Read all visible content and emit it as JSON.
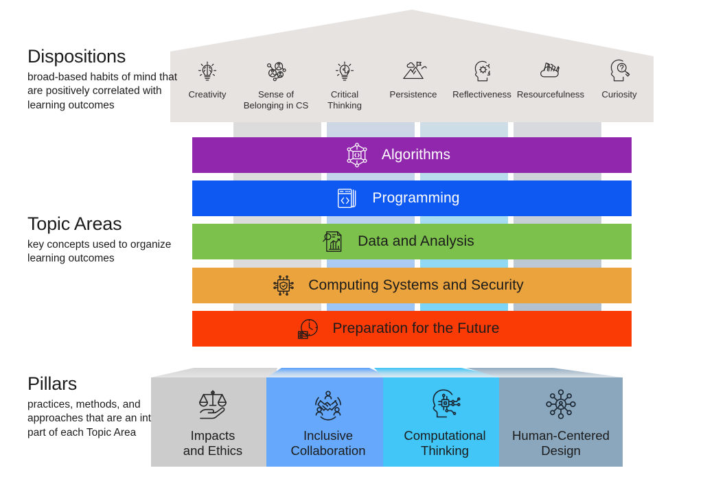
{
  "sections": [
    {
      "key": "dispositions",
      "title": "Dispositions",
      "desc": "broad-based habits of mind that are positively correlated with learning outcomes"
    },
    {
      "key": "topic_areas",
      "title": "Topic Areas",
      "desc": "key concepts used to organize learning outcomes"
    },
    {
      "key": "pillars",
      "title": "Pillars",
      "desc": "practices, methods, and approaches that are an integral part of each Topic Area"
    }
  ],
  "dispositions": {
    "background_color": "#e7e3e0",
    "items": [
      {
        "label": "Creativity",
        "icon": "lightbulb-brain-icon"
      },
      {
        "label": "Sense of\nBelonging in CS",
        "icon": "people-network-icon"
      },
      {
        "label": "Critical\nThinking",
        "icon": "lightbulb-puzzle-icon"
      },
      {
        "label": "Persistence",
        "icon": "mountain-flag-icon"
      },
      {
        "label": "Reflectiveness",
        "icon": "head-gear-icon"
      },
      {
        "label": "Resourcefulness",
        "icon": "toolbox-supplies-icon"
      },
      {
        "label": "Curiosity",
        "icon": "head-magnifier-icon"
      }
    ]
  },
  "topic_areas": {
    "bars": [
      {
        "label": "Algorithms",
        "color": "#9127ac",
        "text_color": "#ffffff",
        "icon": "algorithm-node-icon"
      },
      {
        "label": "Programming",
        "color": "#0d59f2",
        "text_color": "#ffffff",
        "icon": "code-window-icon"
      },
      {
        "label": "Data and Analysis",
        "color": "#7cc14b",
        "text_color": "#1b1b1b",
        "icon": "data-chart-magnifier-icon"
      },
      {
        "label": "Computing Systems and Security",
        "color": "#eba33e",
        "text_color": "#1b1b1b",
        "icon": "chip-shield-icon"
      },
      {
        "label": "Preparation for the Future",
        "color": "#fb3b05",
        "text_color": "#1b1b1b",
        "icon": "clock-books-icon"
      }
    ]
  },
  "pillars": {
    "items": [
      {
        "label": "Impacts\nand Ethics",
        "icon": "scales-hand-icon",
        "face_color": "#cccccc",
        "top_color_start": "#e2e2e2",
        "top_color_end": "#d2d2d2"
      },
      {
        "label": "Inclusive\nCollaboration",
        "icon": "handshake-people-icon",
        "face_color": "#66a8fb",
        "top_color_start": "#3f8ef8",
        "top_color_end": "#dfeaf6"
      },
      {
        "label": "Computational\nThinking",
        "icon": "head-circuit-icon",
        "face_color": "#41c6f7",
        "top_color_start": "#2ec0f5",
        "top_color_end": "#e0eef4"
      },
      {
        "label": "Human-Centered\nDesign",
        "icon": "user-network-icon",
        "face_color": "#8ba7bd",
        "top_color_start": "#93aec2",
        "top_color_end": "#e2e8ed"
      }
    ]
  }
}
